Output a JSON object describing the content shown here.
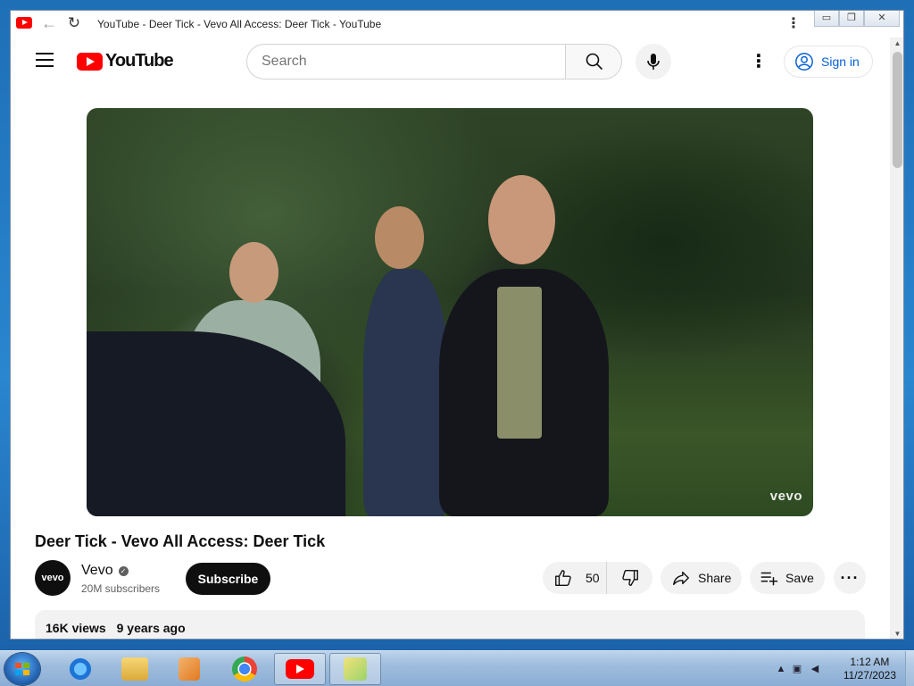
{
  "window": {
    "title": "YouTube - Deer Tick - Vevo All Access: Deer Tick - YouTube",
    "menu_glyph": "⋮",
    "controls": [
      "▭",
      "❐",
      "✕"
    ]
  },
  "browser_nav": {
    "back_glyph": "←",
    "reload_glyph": "↻"
  },
  "header": {
    "logo_text": "YouTube",
    "search_placeholder": "Search",
    "more_glyph": "⋮",
    "signin_label": "Sign in"
  },
  "video": {
    "watermark": "vevo",
    "title": "Deer Tick - Vevo All Access: Deer Tick"
  },
  "channel": {
    "avatar_text": "vevo",
    "name": "Vevo",
    "subscribers": "20M subscribers",
    "subscribe_label": "Subscribe"
  },
  "actions": {
    "like_count": "50",
    "share_label": "Share",
    "save_label": "Save",
    "more_glyph": "···"
  },
  "description": {
    "views": "16K views",
    "age": "9 years ago"
  },
  "taskbar": {
    "items": [
      "internet-explorer",
      "file-explorer",
      "media-player",
      "chrome",
      "youtube",
      "app"
    ],
    "clock_time": "1:12 AM",
    "clock_date": "11/27/2023"
  },
  "colors": {
    "youtube_red": "#ff0000",
    "link_blue": "#065fd4",
    "subscribe_bg": "#0f0f0f"
  }
}
